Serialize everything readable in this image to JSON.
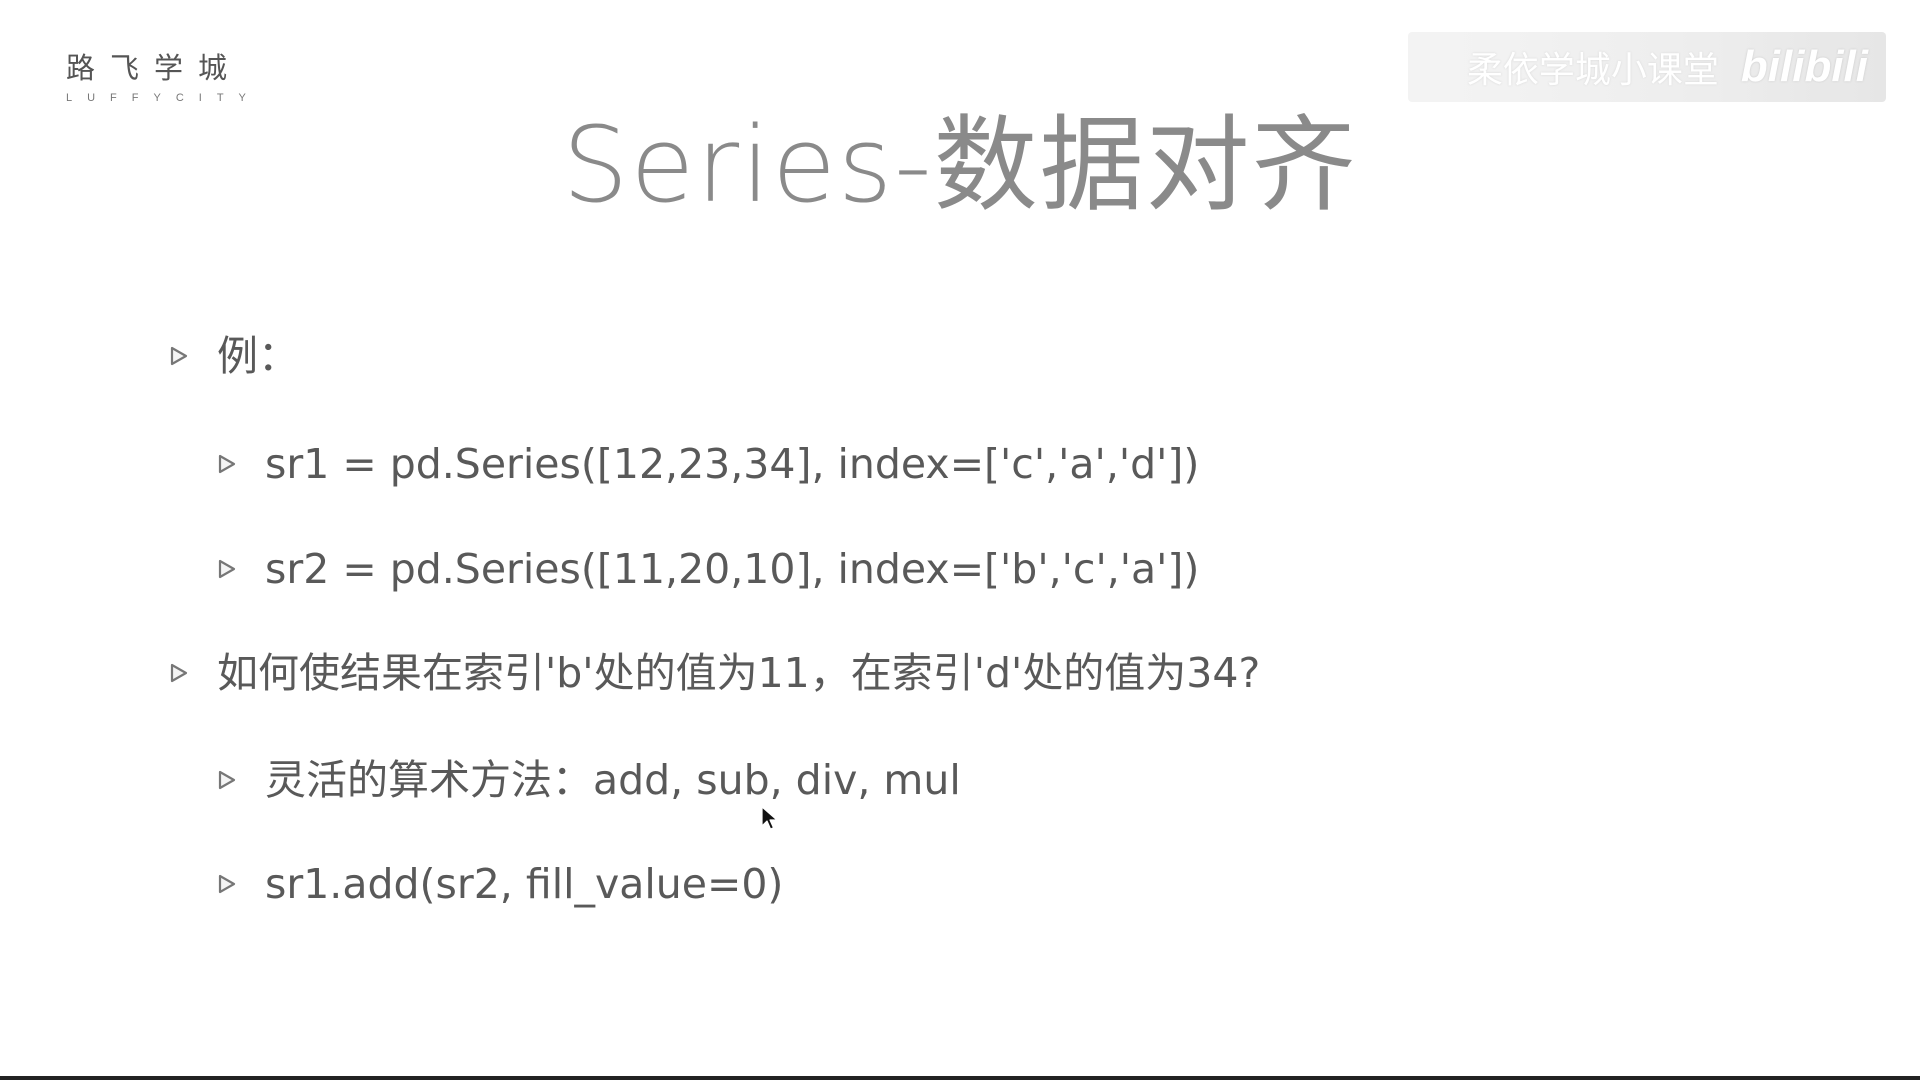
{
  "logo": {
    "chinese": "路飞学城",
    "english": "LUFFYCITY"
  },
  "watermark": {
    "text": "柔依学城小课堂",
    "brand": "bilibili"
  },
  "slide": {
    "title": "Series-数据对齐",
    "bullets": [
      {
        "level": 1,
        "text": "例："
      },
      {
        "level": 2,
        "text": "sr1 = pd.Series([12,23,34], index=['c','a','d'])"
      },
      {
        "level": 2,
        "text": "sr2 = pd.Series([11,20,10], index=['b','c','a'])"
      },
      {
        "level": 1,
        "text": "如何使结果在索引'b'处的值为11，在索引'd'处的值为34?"
      },
      {
        "level": 2,
        "text": "灵活的算术方法：add, sub, div, mul"
      },
      {
        "level": 2,
        "text": "sr1.add(sr2, fill_value=0)"
      }
    ]
  },
  "colors": {
    "text": "#595959",
    "title": "#8a8a8a",
    "bullet_marker": "#777777",
    "background": "#ffffff"
  },
  "icons": {
    "bullet": "play-triangle-outline-icon",
    "cursor": "mouse-pointer-icon"
  }
}
